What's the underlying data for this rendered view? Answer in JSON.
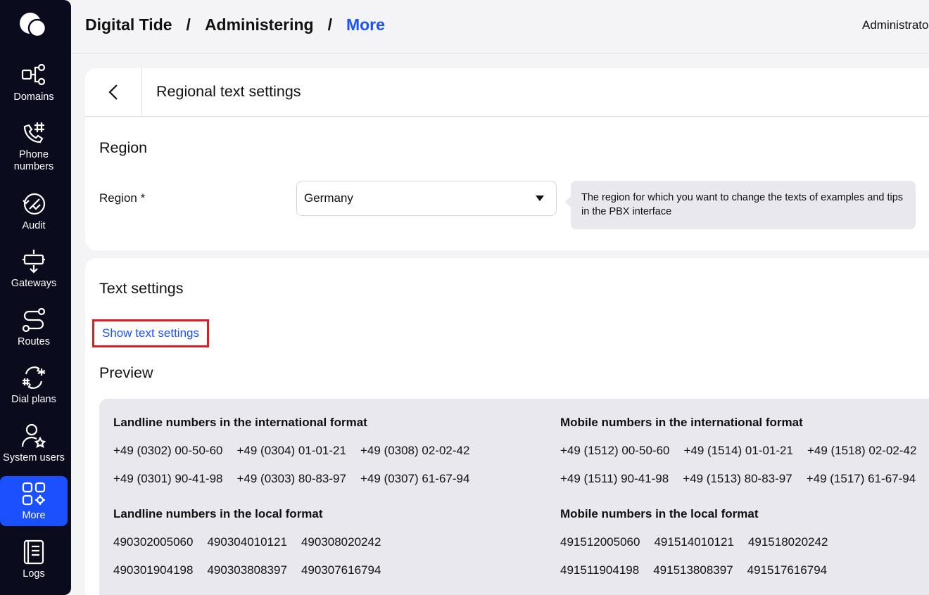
{
  "sidebar": {
    "items": [
      {
        "label": "Domains",
        "icon": "domains-icon"
      },
      {
        "label": "Phone\nnumbers",
        "icon": "phone-numbers-icon"
      },
      {
        "label": "Audit",
        "icon": "audit-icon"
      },
      {
        "label": "Gateways",
        "icon": "gateways-icon"
      },
      {
        "label": "Routes",
        "icon": "routes-icon"
      },
      {
        "label": "Dial plans",
        "icon": "dial-plans-icon"
      },
      {
        "label": "System users",
        "icon": "system-users-icon"
      },
      {
        "label": "More",
        "icon": "more-icon",
        "active": true
      },
      {
        "label": "Logs",
        "icon": "logs-icon"
      }
    ],
    "active_color": "#1b50ff",
    "background": "#0b0b1e"
  },
  "header": {
    "breadcrumb": [
      "Digital Tide",
      "Administering",
      "More"
    ],
    "separator": "/",
    "user": "Administrator"
  },
  "page": {
    "title": "Regional text settings",
    "region_section": {
      "title": "Region",
      "field_label": "Region *",
      "selected": "Germany",
      "hint": "The region for which you want to change the texts of examples and tips in the PBX interface"
    },
    "text_section": {
      "title": "Text settings",
      "show_link": "Show text settings",
      "preview_title": "Preview"
    },
    "preview": {
      "landline_international": {
        "title": "Landline numbers in the international format",
        "rows": [
          [
            "+49 (0302) 00-50-60",
            "+49 (0304) 01-01-21",
            "+49 (0308) 02-02-42"
          ],
          [
            "+49 (0301) 90-41-98",
            "+49 (0303) 80-83-97",
            "+49 (0307) 61-67-94"
          ]
        ]
      },
      "mobile_international": {
        "title": "Mobile numbers in the international format",
        "rows": [
          [
            "+49 (1512) 00-50-60",
            "+49 (1514) 01-01-21",
            "+49 (1518) 02-02-42"
          ],
          [
            "+49 (1511) 90-41-98",
            "+49 (1513) 80-83-97",
            "+49 (1517) 61-67-94"
          ]
        ]
      },
      "landline_local": {
        "title": "Landline numbers in the local format",
        "rows": [
          [
            "490302005060",
            "490304010121",
            "490308020242"
          ],
          [
            "490301904198",
            "490303808397",
            "490307616794"
          ]
        ]
      },
      "mobile_local": {
        "title": "Mobile numbers in the local format",
        "rows": [
          [
            "491512005060",
            "491514010121",
            "491518020242"
          ],
          [
            "491511904198",
            "491513808397",
            "491517616794"
          ]
        ]
      }
    }
  }
}
